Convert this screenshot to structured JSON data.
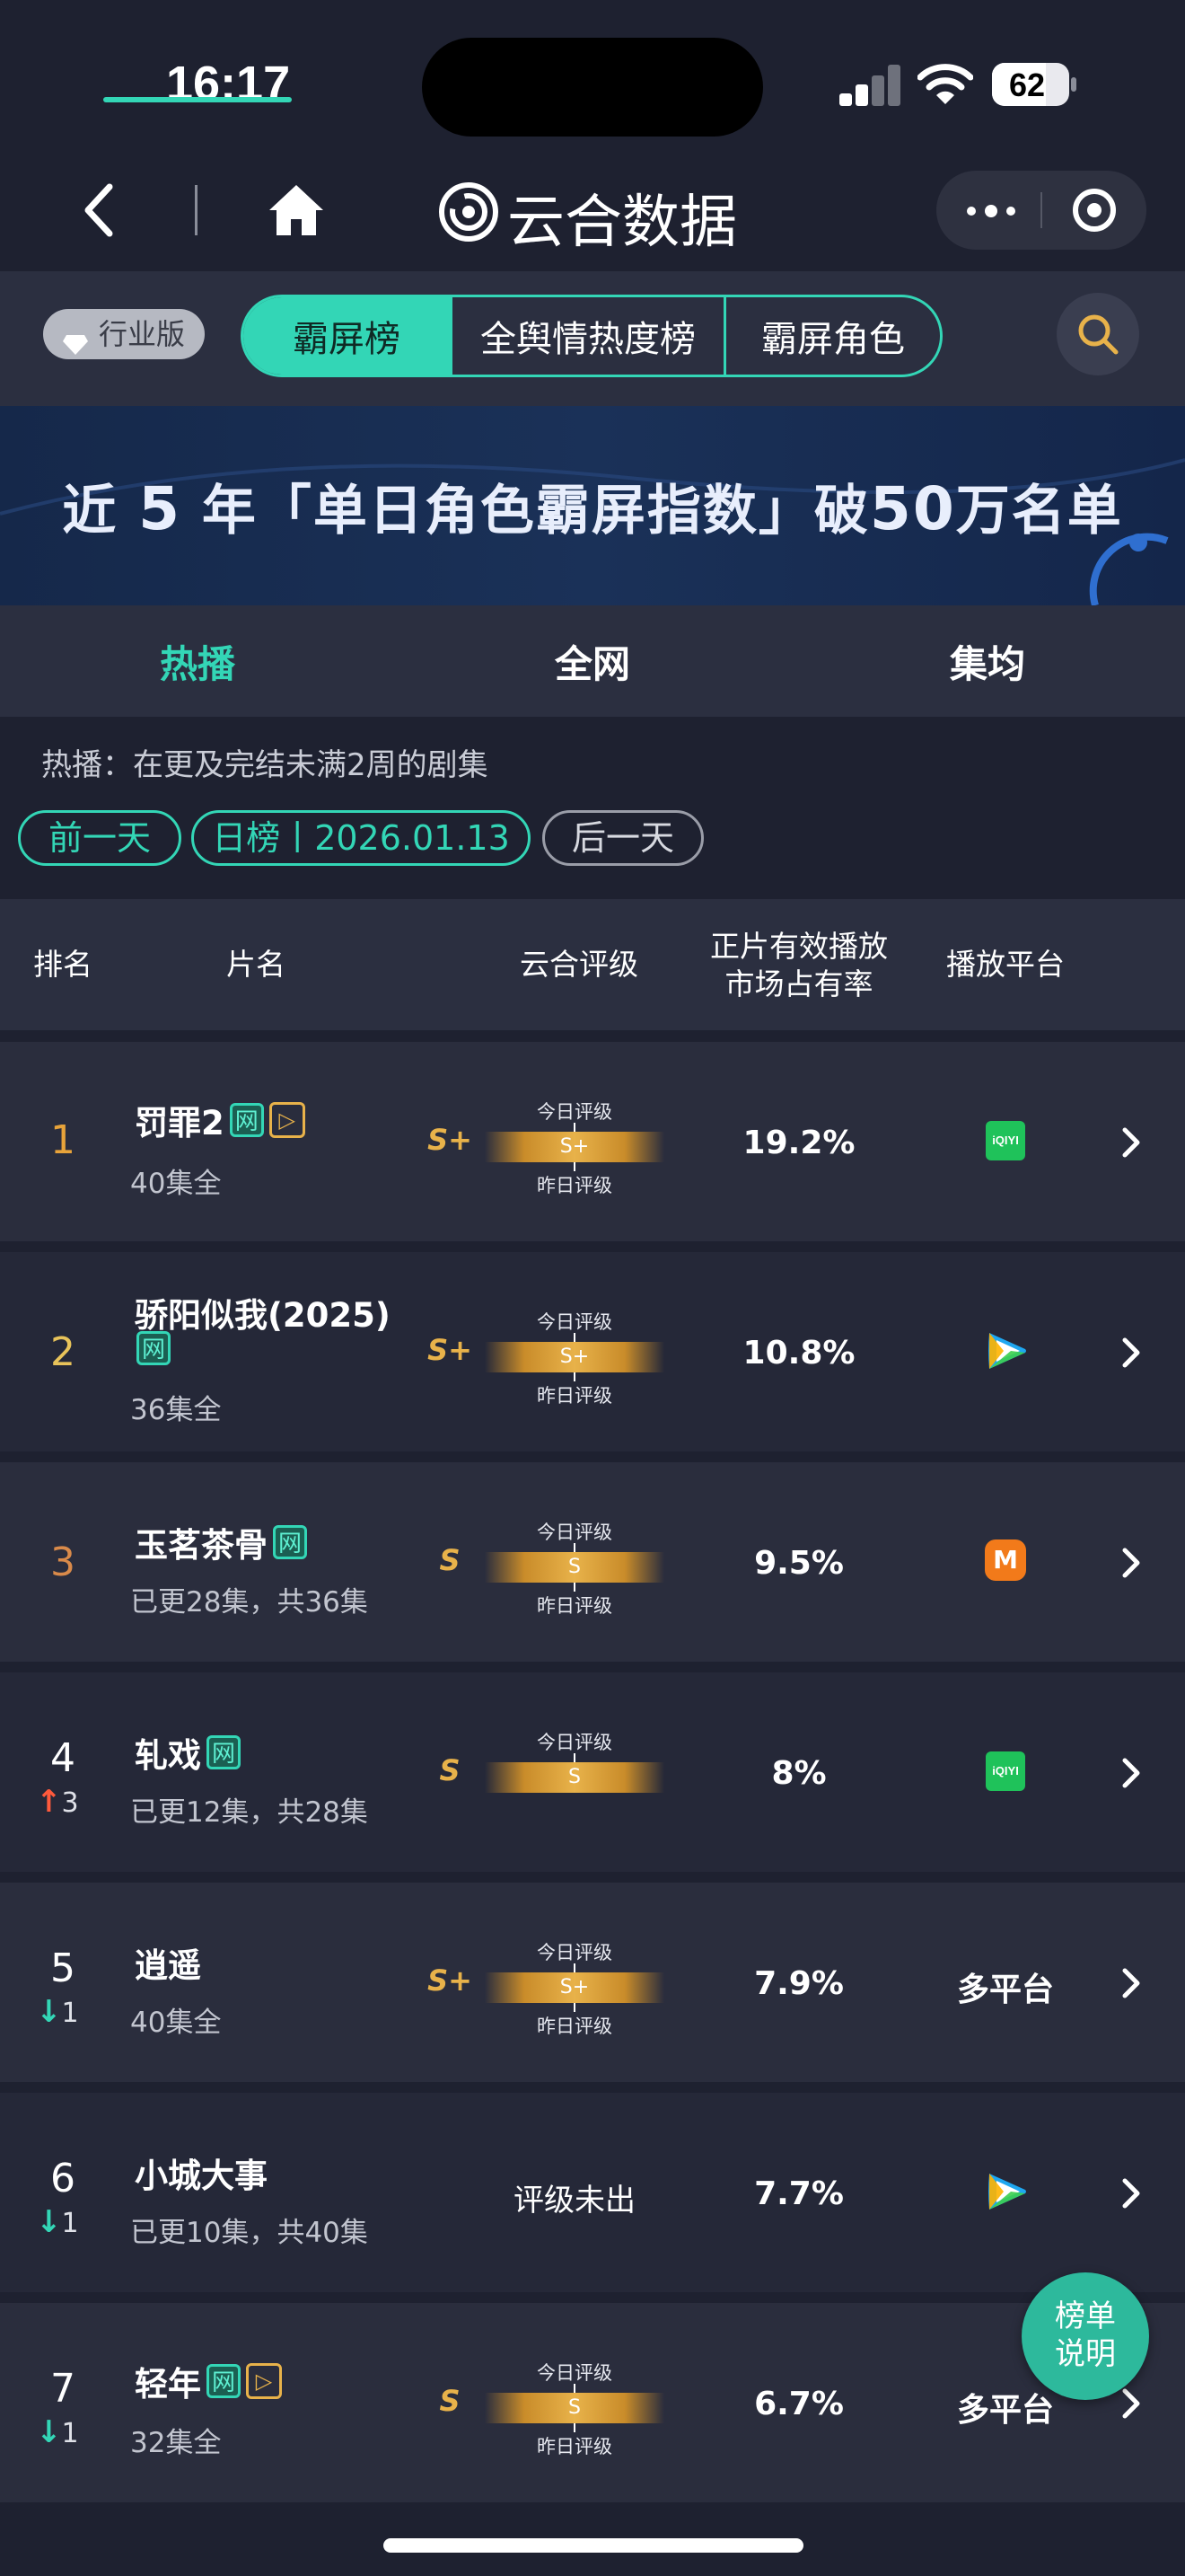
{
  "status_bar": {
    "time": "16:17",
    "battery": "62"
  },
  "nav": {
    "title": "云合数据"
  },
  "toolbar": {
    "badge": "行业版",
    "segments": [
      "霸屏榜",
      "全舆情热度榜",
      "霸屏角色"
    ]
  },
  "banner": {
    "text_a": "近",
    "text_b": "5",
    "text_c": "年「单日角色霸屏指数」破",
    "text_d": "50",
    "text_e": "万名单"
  },
  "tabs": [
    "热播",
    "全网",
    "集均"
  ],
  "hint": "热播：在更及完结未满2周的剧集",
  "date_controls": {
    "prev": "前一天",
    "current": "日榜丨2026.01.13",
    "next": "后一天"
  },
  "table_header": {
    "rank": "排名",
    "name": "片名",
    "rating": "云合评级",
    "share_line1": "正片有效播放",
    "share_line2": "市场占有率",
    "platform": "播放平台"
  },
  "rating_labels": {
    "today": "今日评级",
    "yesterday": "昨日评级"
  },
  "rows": [
    {
      "rank": "1",
      "change": "",
      "title": "罚罪2",
      "title_line2": "",
      "web": "网",
      "episodes": "40集全",
      "grade": "S+",
      "bar": "S+",
      "share": "19.2%",
      "platform": "iQIYI"
    },
    {
      "rank": "2",
      "change": "",
      "title": "骄阳似我(2025)",
      "title_line2": "",
      "web": "网",
      "episodes": "36集全",
      "grade": "S+",
      "bar": "S+",
      "share": "10.8%",
      "platform": ""
    },
    {
      "rank": "3",
      "change": "",
      "title": "玉茗茶骨",
      "title_line2": "",
      "web": "网",
      "episodes": "已更28集，共36集",
      "grade": "S",
      "bar": "S",
      "share": "9.5%",
      "platform": "M"
    },
    {
      "rank": "4",
      "change": "3",
      "title": "轧戏",
      "title_line2": "",
      "web": "网",
      "episodes": "已更12集，共28集",
      "grade": "S",
      "bar": "S",
      "share": "8%",
      "platform": "iQIYI"
    },
    {
      "rank": "5",
      "change": "1",
      "title": "逍遥",
      "title_line2": "",
      "web": "",
      "episodes": "40集全",
      "grade": "S+",
      "bar": "S+",
      "share": "7.9%",
      "platform": "多平台"
    },
    {
      "rank": "6",
      "change": "1",
      "title": "小城大事",
      "title_line2": "",
      "web": "",
      "episodes": "已更10集，共40集",
      "grade": "",
      "bar": "评级未出",
      "share": "7.7%",
      "platform": ""
    },
    {
      "rank": "7",
      "change": "1",
      "title": "轻年",
      "title_line2": "",
      "web": "网",
      "episodes": "32集全",
      "grade": "S",
      "bar": "S",
      "share": "6.7%",
      "platform": "多平台"
    }
  ],
  "float_button": {
    "line1": "榜单",
    "line2": "说明"
  },
  "colors": {
    "accent": "#33d6b6",
    "gold": "#e8b24a",
    "up": "#ff5a3c",
    "down": "#33d6b6"
  }
}
